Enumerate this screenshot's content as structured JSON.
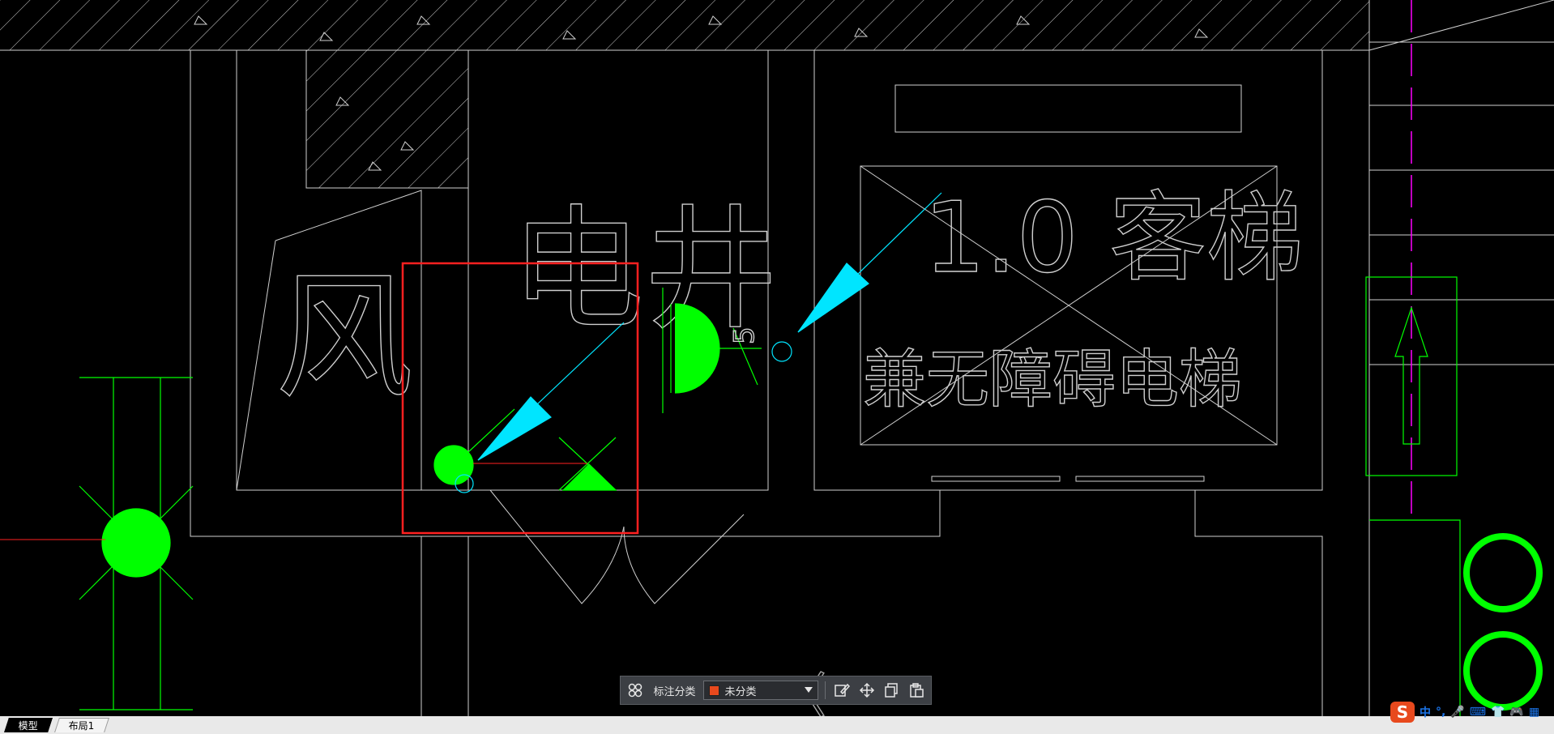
{
  "drawing": {
    "labels": {
      "shaft": "风",
      "elec_well": "电井",
      "elevator_spec": "1.0 客梯",
      "elevator_type": "兼无障碍电梯",
      "dim_number": "5"
    }
  },
  "toolbar": {
    "category_label": "标注分类",
    "selected_category": "未分类",
    "selected_color": "#e8491d",
    "icons": [
      "grid-icon",
      "edit-icon",
      "move-icon",
      "copy-icon",
      "paste-icon"
    ]
  },
  "layout_tabs": [
    {
      "label": "模型",
      "active": true
    },
    {
      "label": "布局1",
      "active": false
    }
  ],
  "ime_tray": {
    "logo": "S",
    "lang": "中",
    "items": [
      "°,",
      "🎤",
      "⌨",
      "👕",
      "🎮",
      "▦"
    ]
  },
  "colors": {
    "background": "#000000",
    "line": "#cfcfcf",
    "green": "#00ff00",
    "cyan": "#00e5ff",
    "red": "#ff2020",
    "magenta": "#ff00ff"
  }
}
